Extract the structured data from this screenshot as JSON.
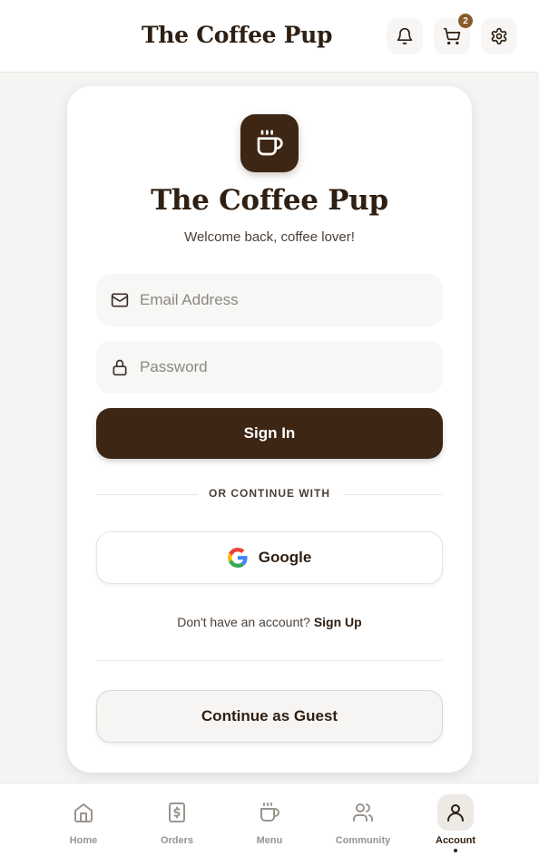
{
  "header": {
    "brand": "The Coffee Pup",
    "cart_count": "2",
    "icons": [
      "bell-icon",
      "cart-icon",
      "gear-icon"
    ]
  },
  "login": {
    "title": "The Coffee Pup",
    "subtitle": "Welcome back, coffee lover!",
    "email_placeholder": "Email Address",
    "password_placeholder": "Password",
    "sign_in_label": "Sign In",
    "divider_text": "OR CONTINUE WITH",
    "google_label": "Google",
    "signup_prompt": "Don't have an account?",
    "signup_link": "Sign Up",
    "guest_label": "Continue as Guest"
  },
  "nav": {
    "items": [
      {
        "label": "Home",
        "icon": "home-icon",
        "active": false
      },
      {
        "label": "Orders",
        "icon": "receipt-icon",
        "active": false
      },
      {
        "label": "Menu",
        "icon": "coffee-cup-icon",
        "active": false
      },
      {
        "label": "Community",
        "icon": "users-icon",
        "active": false
      },
      {
        "label": "Account",
        "icon": "user-icon",
        "active": true
      }
    ]
  },
  "colors": {
    "brand_dark": "#3d2614",
    "badge": "#8a5a2b",
    "background": "#f5f4f3"
  }
}
